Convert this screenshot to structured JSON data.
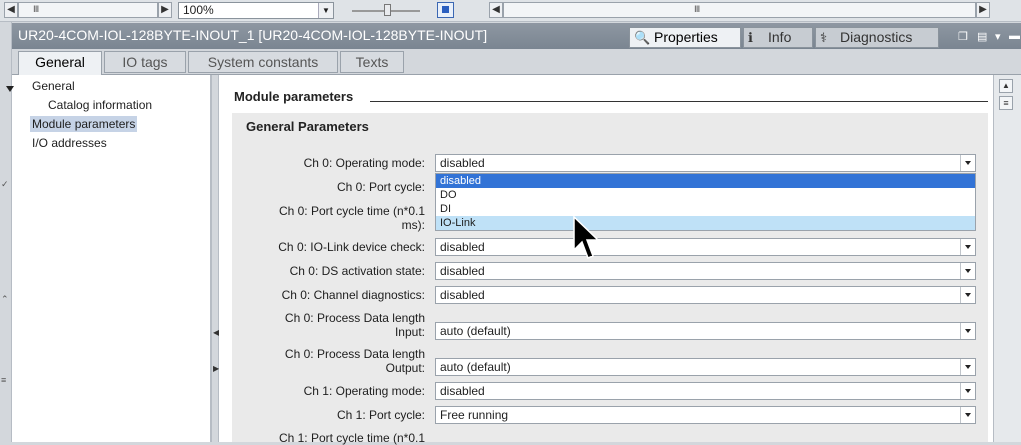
{
  "toolbar": {
    "zoom_value": "100%",
    "scroll_left": "Ⅲ",
    "scroll_mid": "Ⅲ"
  },
  "window": {
    "title": "UR20-4COM-IOL-128BYTE-INOUT_1  [UR20-4COM-IOL-128BYTE-INOUT]",
    "tabs": [
      {
        "label": "Properties",
        "icon": "properties-icon"
      },
      {
        "label": "Info",
        "icon": "info-icon"
      },
      {
        "label": "Diagnostics",
        "icon": "diagnostics-icon"
      }
    ]
  },
  "subtabs": [
    "General",
    "IO tags",
    "System constants",
    "Texts"
  ],
  "nav": {
    "general": "General",
    "catalog": "Catalog information",
    "module_params": "Module parameters",
    "io_addresses": "I/O addresses"
  },
  "section": {
    "title": "Module parameters",
    "group_title": "General Parameters"
  },
  "params": [
    {
      "label": "Ch 0: Operating mode:",
      "value": "disabled"
    },
    {
      "label": "Ch 0: Port cycle:",
      "value": ""
    },
    {
      "label_line1": "Ch 0: Port cycle time (n*0.1",
      "label_line2": "ms):",
      "value": ""
    },
    {
      "label": "Ch 0: IO-Link device check:",
      "value": "disabled"
    },
    {
      "label": "Ch 0: DS activation state:",
      "value": "disabled"
    },
    {
      "label": "Ch 0: Channel diagnostics:",
      "value": "disabled"
    },
    {
      "label_line1": "Ch 0: Process Data length",
      "label_line2": "Input:",
      "value": "auto (default)"
    },
    {
      "label_line1": "Ch 0: Process Data length",
      "label_line2": "Output:",
      "value": "auto (default)"
    },
    {
      "label": "Ch 1: Operating mode:",
      "value": "disabled"
    },
    {
      "label": "Ch 1: Port cycle:",
      "value": "Free running"
    },
    {
      "label": "Ch 1: Port cycle time (n*0.1",
      "value": ""
    }
  ],
  "dropdown_options": [
    "disabled",
    "DO",
    "DI",
    "IO-Link"
  ],
  "colors": {
    "selection": "#3273d6",
    "hover": "#bfe1f7",
    "titlebar": "#7a8591"
  }
}
